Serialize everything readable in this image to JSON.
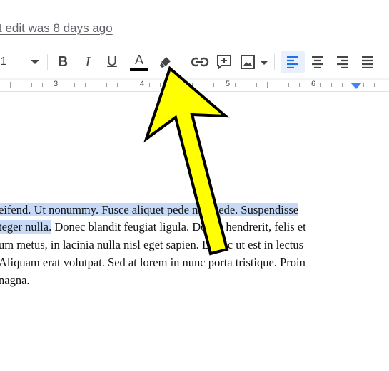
{
  "header": {
    "last_edit": "t edit was 8 days ago"
  },
  "toolbar": {
    "font_size": "1",
    "bold": "B",
    "italic": "I",
    "underline": "U",
    "text_color_letter": "A",
    "text_color_bar": "#000000",
    "icons": [
      "chevron-down-icon",
      "highlighter-icon",
      "link-icon",
      "add-comment-icon",
      "image-icon",
      "align-left-icon",
      "align-center-icon",
      "align-right-icon",
      "align-justify-icon"
    ]
  },
  "ruler": {
    "numbers": [
      "3",
      "4",
      "5",
      "6"
    ]
  },
  "document": {
    "lines": [
      {
        "highlighted": "eifend. Ut nonummy. Fusce aliquet pede non pede. Suspendisse",
        "rest": ""
      },
      {
        "highlighted": "teger nulla.",
        "rest": " Donec blandit feugiat ligula. Donec hendrerit, felis et"
      },
      {
        "highlighted": "",
        "rest": "um metus, in lacinia nulla nisl eget sapien. Donec ut est in lectus"
      },
      {
        "highlighted": "",
        "rest": "Aliquam erat volutpat. Sed at lorem in nunc porta tristique. Proin"
      },
      {
        "highlighted": "",
        "rest": "nagna."
      }
    ],
    "highlight_color": "#c6d9f6"
  },
  "annotation": {
    "arrow_fill": "#ffff00",
    "arrow_stroke": "#000000"
  }
}
